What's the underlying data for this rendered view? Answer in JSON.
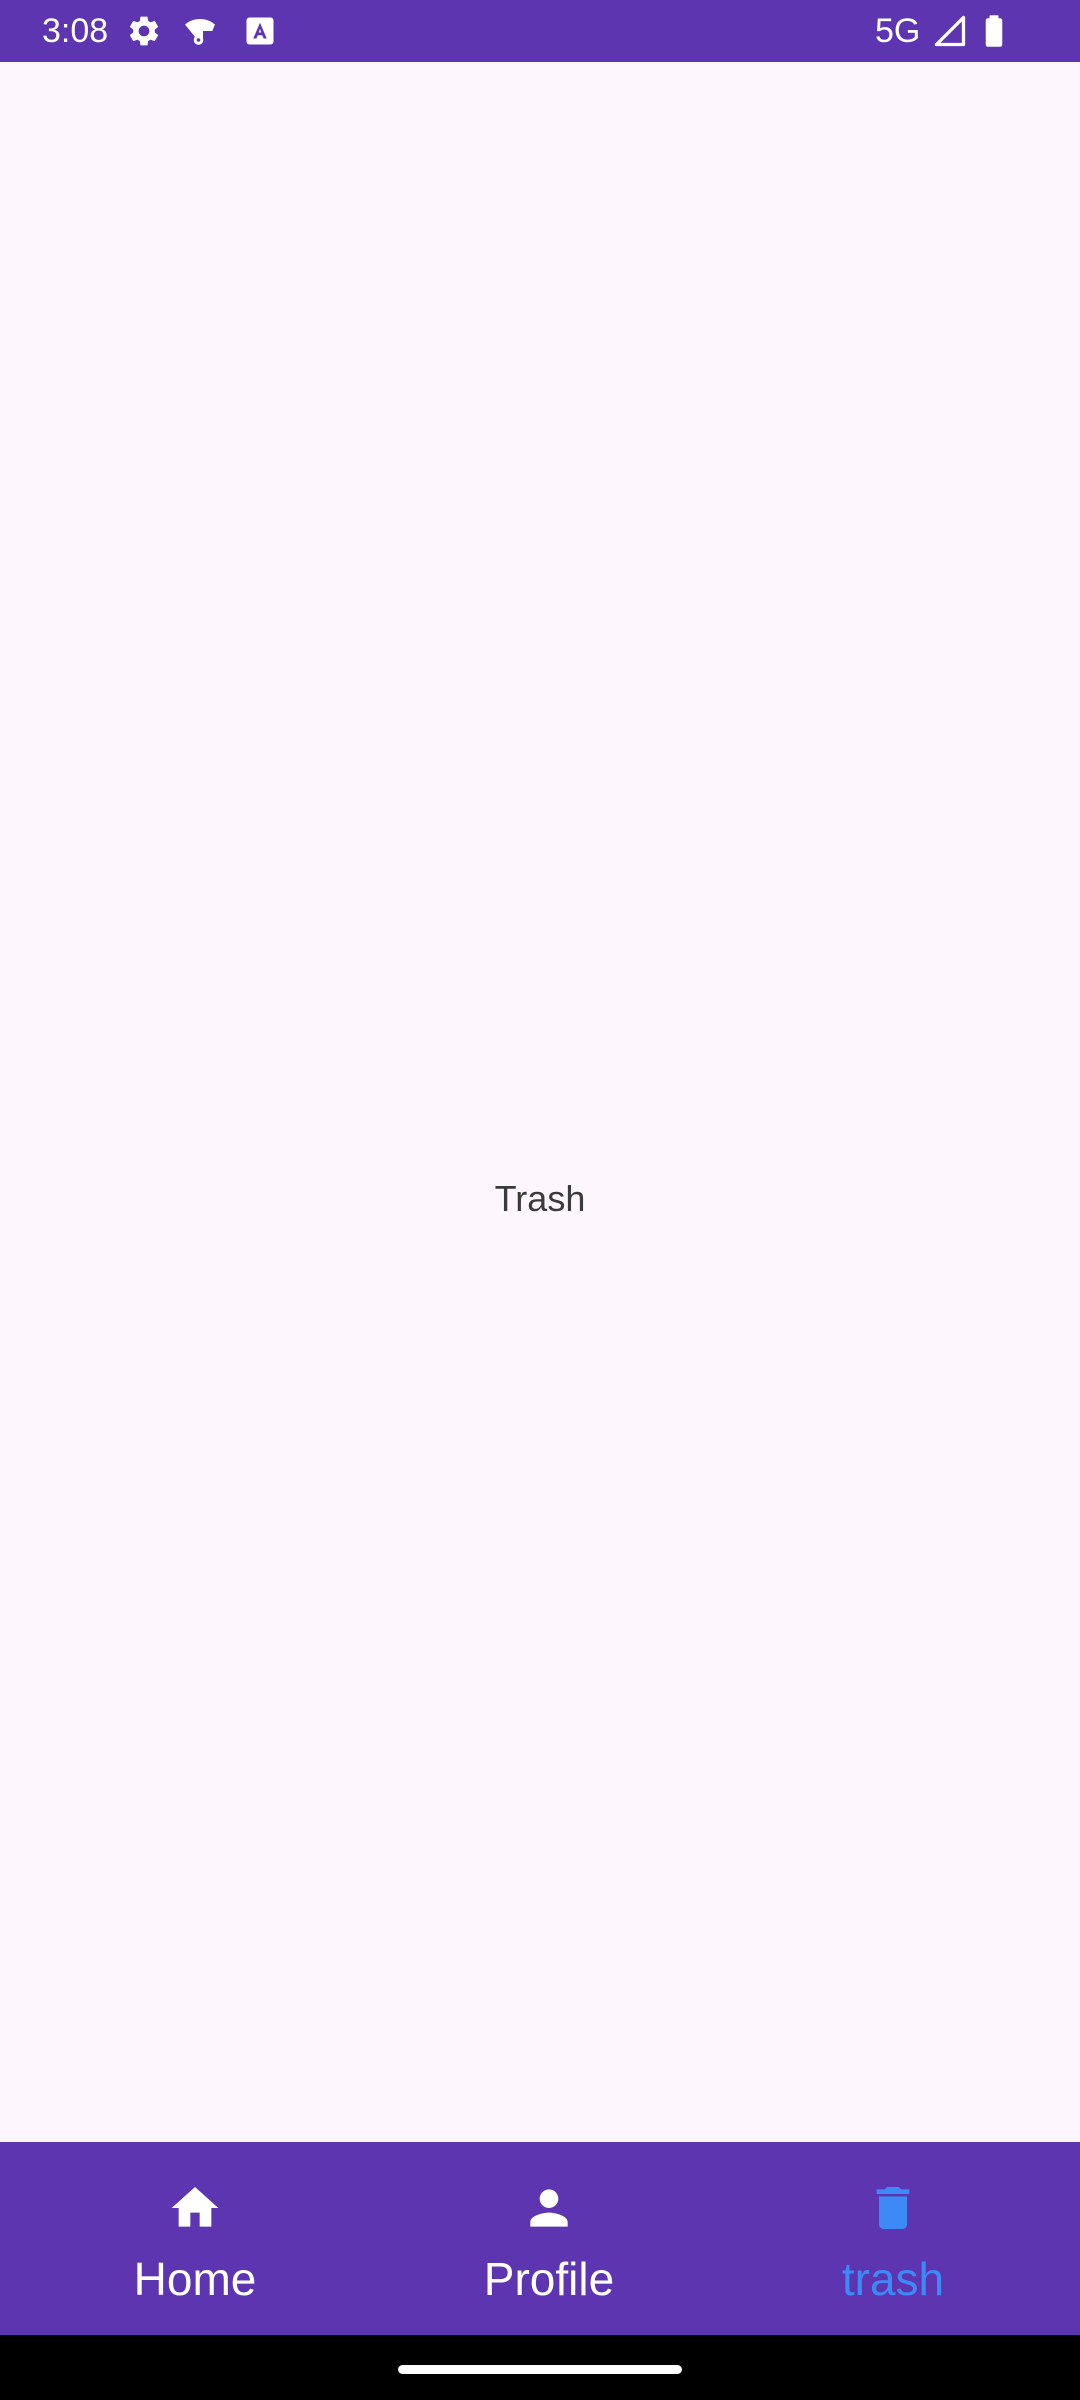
{
  "status_bar": {
    "time": "3:08",
    "network": "5G",
    "icons": [
      "gear-icon",
      "wifi-settings-icon",
      "a-notification-icon",
      "signal-icon",
      "battery-icon"
    ],
    "background": "#5e35b1"
  },
  "main": {
    "label": "Trash",
    "background": "#fdf7fd"
  },
  "bottom_nav": {
    "background": "#5e35b1",
    "active_color": "#3d8af7",
    "items": [
      {
        "label": "Home",
        "icon": "home-icon",
        "active": false
      },
      {
        "label": "Profile",
        "icon": "person-icon",
        "active": false
      },
      {
        "label": "trash",
        "icon": "trash-icon",
        "active": true
      }
    ]
  }
}
